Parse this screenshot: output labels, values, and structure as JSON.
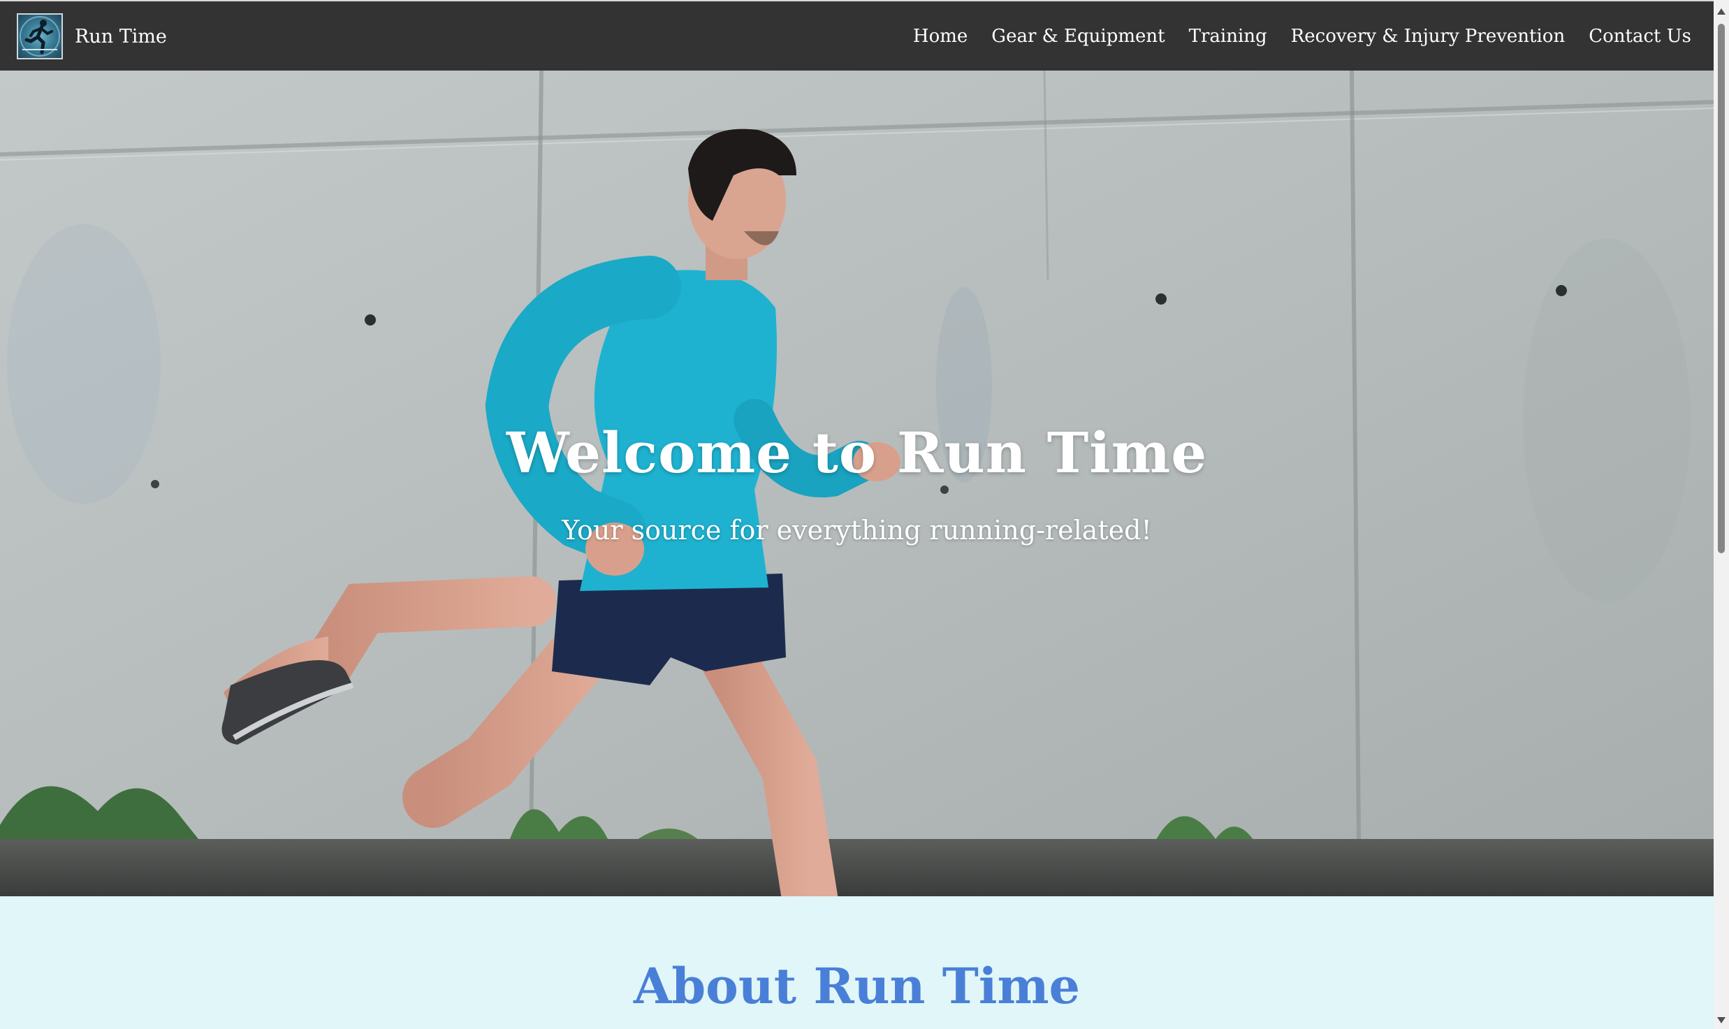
{
  "navbar": {
    "brand": "Run Time",
    "links": [
      "Home",
      "Gear & Equipment",
      "Training",
      "Recovery & Injury Prevention",
      "Contact Us"
    ]
  },
  "hero": {
    "title": "Welcome to Run Time",
    "subtitle": "Your source for everything running-related!"
  },
  "about": {
    "title": "About Run Time"
  },
  "colors": {
    "navbar_bg": "#333333",
    "about_bg": "#e0f6f8",
    "about_title": "#4a7fd8",
    "runner_shirt": "#1fb2d0",
    "runner_shorts": "#1c2b4d"
  },
  "icons": {
    "logo": "running-man-logo"
  }
}
